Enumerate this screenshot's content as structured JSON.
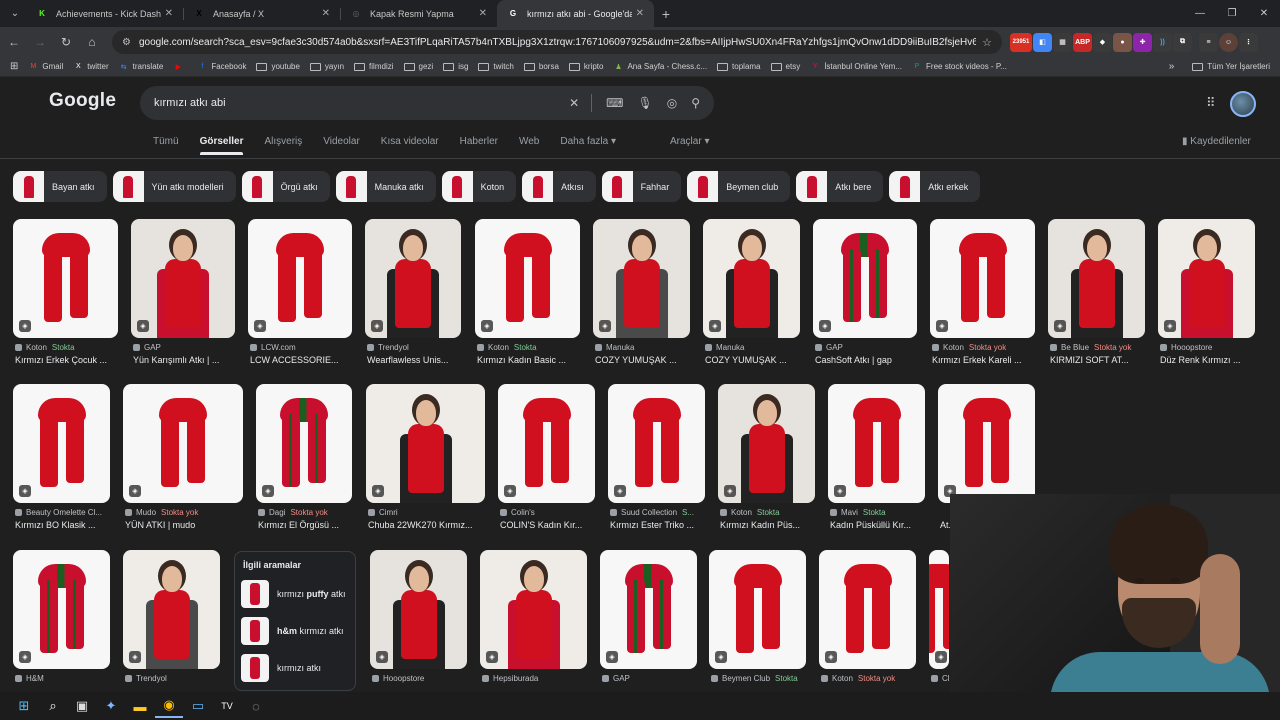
{
  "browser": {
    "tabs": [
      {
        "title": "Achievements - Kick Dashboard",
        "icon": "kick-icon",
        "color": "#53fc18",
        "glyph": "K"
      },
      {
        "title": "Anasayfa / X",
        "icon": "x-icon",
        "color": "#000000",
        "glyph": "X"
      },
      {
        "title": "Kapak Resmi Yapma",
        "icon": "globe-icon",
        "color": "#5f6368",
        "glyph": "◎"
      },
      {
        "title": "kırmızı atkı abi - Google'da Ara",
        "icon": "google-icon",
        "color": "#ffffff",
        "glyph": "G",
        "active": true
      }
    ],
    "url": "google.com/search?sca_esv=9cfae3c30d574a0b&sxsrf=AE3TifPLqaRiTA57b4nTXBLjpg3X1ztrqw:1767106097925&udm=2&fbs=AIIjpHwSU0Xn4FRaYzhfgs1jmQvOnw1dDD9iiBuIB2fsjeHv6XuKgDzU9KpxZ...",
    "ext_badge": "23951",
    "bookmarks": [
      {
        "label": "Gmail",
        "type": "site",
        "glyph": "M",
        "color": "#ea4335"
      },
      {
        "label": "twitter",
        "type": "site",
        "glyph": "X",
        "color": "#ffffff"
      },
      {
        "label": "translate",
        "type": "site",
        "glyph": "⇆",
        "color": "#4285f4"
      },
      {
        "label": "",
        "type": "site",
        "glyph": "▶",
        "color": "#ff0000"
      },
      {
        "label": "Facebook",
        "type": "site",
        "glyph": "f",
        "color": "#1877f2"
      },
      {
        "label": "youtube",
        "type": "folder"
      },
      {
        "label": "yayın",
        "type": "folder"
      },
      {
        "label": "filmdizi",
        "type": "folder"
      },
      {
        "label": "gezi",
        "type": "folder"
      },
      {
        "label": "isg",
        "type": "folder"
      },
      {
        "label": "twitch",
        "type": "folder"
      },
      {
        "label": "borsa",
        "type": "folder"
      },
      {
        "label": "kripto",
        "type": "folder"
      },
      {
        "label": "Ana Sayfa - Chess.c...",
        "type": "site",
        "glyph": "♟",
        "color": "#81b64c"
      },
      {
        "label": "toplama",
        "type": "folder"
      },
      {
        "label": "etsy",
        "type": "folder"
      },
      {
        "label": "İstanbul Online Yem...",
        "type": "site",
        "glyph": "Y",
        "color": "#fa0050"
      },
      {
        "label": "Free stock videos - P...",
        "type": "site",
        "glyph": "P",
        "color": "#05a081"
      }
    ],
    "all_bookmarks": "Tüm Yer İşaretleri"
  },
  "google": {
    "logo": "Google",
    "query": "kırmızı atkı abi",
    "nav": [
      "Tümü",
      "Görseller",
      "Alışveriş",
      "Videolar",
      "Kısa videolar",
      "Haberler",
      "Web",
      "Daha fazla ▾"
    ],
    "tools": "Araçlar ▾",
    "saved": "Kaydedilenler",
    "chips": [
      "Bayan atkı",
      "Yün atkı modelleri",
      "Örgü atkı",
      "Manuka atkı",
      "Koton",
      "Atkısı",
      "Fahhar",
      "Beymen club",
      "Atkı bere",
      "Atkı erkek"
    ],
    "row1": [
      {
        "source": "Koton",
        "stock": "Stokta",
        "title": "Kırmızı Erkek Çocuk ..."
      },
      {
        "source": "GAP",
        "stock": "",
        "title": "Yün Karışımlı Atkı | ..."
      },
      {
        "source": "LCW.com",
        "stock": "",
        "title": "LCW ACCESSORIE..."
      },
      {
        "source": "Trendyol",
        "stock": "",
        "title": "Wearflawless Unis..."
      },
      {
        "source": "Koton",
        "stock": "Stokta",
        "title": "Kırmızı Kadın Basic ..."
      },
      {
        "source": "Manuka",
        "stock": "",
        "title": "COZY YUMUŞAK ..."
      },
      {
        "source": "Manuka",
        "stock": "",
        "title": "COZY YUMUŞAK ..."
      },
      {
        "source": "GAP",
        "stock": "",
        "title": "CashSoft Atkı | gap"
      },
      {
        "source": "Koton",
        "stock": "Stokta yok",
        "title": "Kırmızı Erkek Kareli ..."
      },
      {
        "source": "Be Blue",
        "stock": "Stokta yok",
        "title": "KIRMIZI SOFT AT..."
      },
      {
        "source": "Hooopstore",
        "stock": "",
        "title": "Düz Renk Kırmızı ..."
      }
    ],
    "row2": [
      {
        "source": "Beauty Omelette Cl...",
        "stock": "",
        "title": "Kırmızı BO Klasik ..."
      },
      {
        "source": "Mudo",
        "stock": "Stokta yok",
        "title": "YÜN ATKI | mudo"
      },
      {
        "source": "Dagi",
        "stock": "Stokta yok",
        "title": "Kırmızı El Örgüsü ..."
      },
      {
        "source": "Cimri",
        "stock": "",
        "title": "Chuba 22WK270 Kırmız..."
      },
      {
        "source": "Colin's",
        "stock": "",
        "title": "COLIN'S Kadın Kır..."
      },
      {
        "source": "Suud Collection",
        "stock": "S...",
        "title": "Kırmızı Ester Triko ..."
      },
      {
        "source": "Koton",
        "stock": "Stokta",
        "title": "Kırmızı Kadın Püs..."
      },
      {
        "source": "Mavi",
        "stock": "Stokta",
        "title": "Kadın Püsküllü Kır..."
      },
      {
        "source": "",
        "stock": "",
        "title": "At..."
      }
    ],
    "row3": [
      {
        "source": "H&M",
        "stock": ""
      },
      {
        "source": "Trendyol",
        "stock": ""
      },
      {
        "source": "Hooopstore",
        "stock": ""
      },
      {
        "source": "Hepsiburada",
        "stock": ""
      },
      {
        "source": "GAP",
        "stock": ""
      },
      {
        "source": "Beymen Club",
        "stock": "Stokta"
      },
      {
        "source": "Koton",
        "stock": "Stokta yok"
      },
      {
        "source": "Cl...",
        "stock": ""
      }
    ],
    "related": {
      "heading": "İlgili aramalar",
      "items": [
        {
          "pre": "kırmızı ",
          "bold": "puffy",
          "post": " atkı"
        },
        {
          "pre": "",
          "bold": "h&m",
          "post": " kırmızı atkı"
        },
        {
          "pre": "kırmızı atkı",
          "bold": "",
          "post": ""
        }
      ]
    }
  },
  "taskbar": [
    {
      "icon": "windows-start-icon",
      "glyph": "⊞",
      "color": "#4cc2ff"
    },
    {
      "icon": "search-icon",
      "glyph": "⌕",
      "color": "#ffffff"
    },
    {
      "icon": "task-view-icon",
      "glyph": "▣",
      "color": "#dddddd"
    },
    {
      "icon": "copilot-icon",
      "glyph": "✦",
      "color": "#7fb8ff"
    },
    {
      "icon": "file-explorer-icon",
      "glyph": "▬",
      "color": "#ffca28"
    },
    {
      "icon": "chrome-icon",
      "glyph": "◉",
      "color": "#fbbc05",
      "active": true
    },
    {
      "icon": "desktop-app-icon",
      "glyph": "▭",
      "color": "#64b5f6"
    },
    {
      "icon": "tradingview-icon",
      "glyph": "TV",
      "color": "#ffffff"
    },
    {
      "icon": "app-icon",
      "glyph": "◌",
      "color": "#bbbbbb"
    }
  ]
}
